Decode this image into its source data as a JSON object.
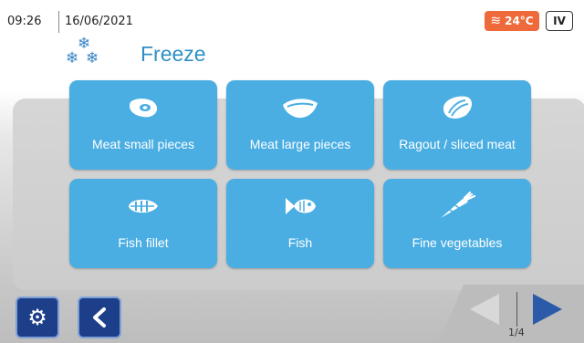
{
  "status": {
    "time": "09:26",
    "date": "16/06/2021",
    "temperature": "24°C",
    "level": "IV"
  },
  "header": {
    "title": "Freeze",
    "icon": "snowflake-icon"
  },
  "tiles": [
    {
      "label": "Meat small pieces",
      "icon": "meat-small-icon"
    },
    {
      "label": "Meat large pieces",
      "icon": "meat-large-icon"
    },
    {
      "label": "Ragout / sliced meat",
      "icon": "ragout-icon"
    },
    {
      "label": "Fish fillet",
      "icon": "fish-fillet-icon"
    },
    {
      "label": "Fish",
      "icon": "fish-icon"
    },
    {
      "label": "Fine vegetables",
      "icon": "carrot-icon"
    }
  ],
  "pagination": {
    "page": "1/4"
  },
  "colors": {
    "tile": "#4aaee3",
    "accent": "#2f8fc5",
    "temp_badge": "#ee6a3a",
    "nav_button": "#1d3f8a"
  }
}
